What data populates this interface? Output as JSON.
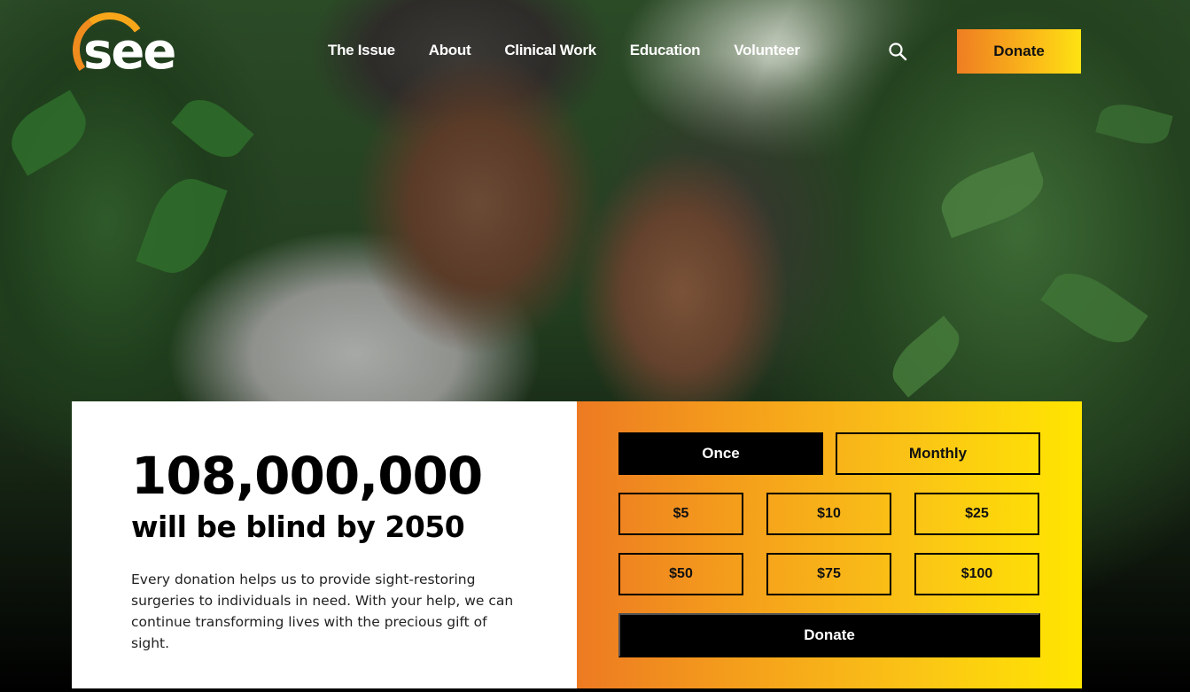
{
  "header": {
    "logo_text": "see",
    "nav": [
      "The Issue",
      "About",
      "Clinical Work",
      "Education",
      "Volunteer"
    ],
    "search_icon": "search-icon",
    "donate_label": "Donate"
  },
  "hero": {
    "image_icon": "hero-photo"
  },
  "impact": {
    "number": "108,000,000",
    "headline": "will be blind by 2050",
    "description": "Every donation helps us to provide sight-restoring surgeries to individuals in need. With your help, we can continue transforming lives with the precious gift of sight."
  },
  "donation": {
    "frequency": [
      "Once",
      "Monthly"
    ],
    "selected_frequency": "Once",
    "amounts": [
      "$5",
      "$10",
      "$25",
      "$50",
      "$75",
      "$100"
    ],
    "submit_label": "Donate"
  },
  "colors": {
    "accent_orange": "#ef7d22",
    "accent_yellow": "#ffe600",
    "dark": "#000000"
  }
}
